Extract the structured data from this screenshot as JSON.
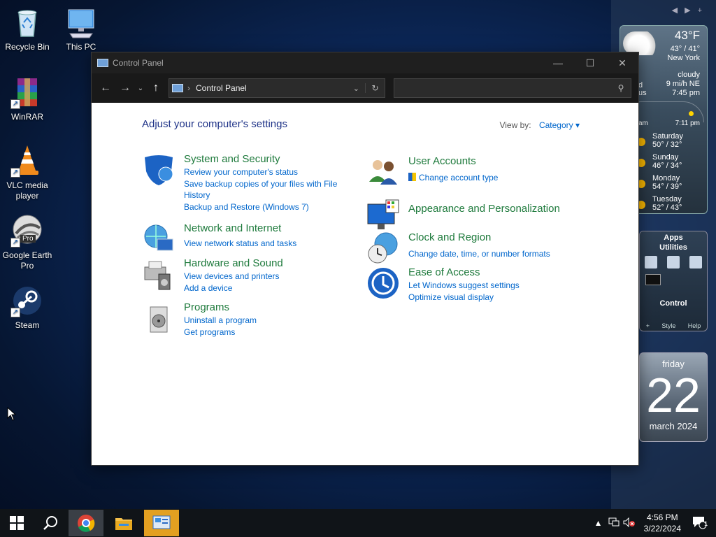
{
  "desktop": {
    "icons": [
      {
        "label": "Recycle Bin"
      },
      {
        "label": "This PC"
      },
      {
        "label": "WinRAR"
      },
      {
        "label": "VLC media player"
      },
      {
        "label": "Google Earth Pro"
      },
      {
        "label": "Steam"
      }
    ],
    "google_earth_badge": "Pro"
  },
  "weather": {
    "temp": "43°F",
    "range": "43° / 41°",
    "city": "New York",
    "condition": "cloudy",
    "wind": "9 mi/h NE",
    "time": "7:45 pm",
    "left_partial_1": "d",
    "left_partial_2": "us",
    "sunrise_partial": "am",
    "sunset": "7:11 pm",
    "forecast": [
      {
        "day": "Saturday",
        "range": "50° / 32°"
      },
      {
        "day": "Sunday",
        "range": "46° / 34°"
      },
      {
        "day": "Monday",
        "range": "54° / 39°"
      },
      {
        "day": "Tuesday",
        "range": "52° / 43°"
      }
    ]
  },
  "apps_gadget": {
    "title": "Apps",
    "subtitle": "Utilities",
    "label": "Control",
    "footer": [
      "+",
      "Style",
      "Help"
    ]
  },
  "calendar": {
    "weekday": "friday",
    "day": "22",
    "month": "march 2024"
  },
  "window": {
    "title": "Control Panel",
    "address": "Control Panel",
    "search_placeholder": "",
    "heading": "Adjust your computer's settings",
    "view_by_label": "View by:",
    "view_by_value": "Category",
    "categories_left": [
      {
        "title": "System and Security",
        "links": [
          "Review your computer's status",
          "Save backup copies of your files with File",
          "History",
          "Backup and Restore (Windows 7)"
        ]
      },
      {
        "title": "Network and Internet",
        "links": [
          "View network status and tasks"
        ]
      },
      {
        "title": "Hardware and Sound",
        "links": [
          "View devices and printers",
          "Add a device"
        ]
      },
      {
        "title": "Programs",
        "links": [
          "Uninstall a program",
          "Get programs"
        ]
      }
    ],
    "categories_right": [
      {
        "title": "User Accounts",
        "links": [
          "Change account type"
        ]
      },
      {
        "title": "Appearance and Personalization",
        "links": []
      },
      {
        "title": "Clock and Region",
        "links": [
          "Change date, time, or number formats"
        ]
      },
      {
        "title": "Ease of Access",
        "links": [
          "Let Windows suggest settings",
          "Optimize visual display"
        ]
      }
    ]
  },
  "taskbar": {
    "time": "4:56 PM",
    "date": "3/22/2024",
    "notification_count": "1"
  },
  "colors": {
    "link": "#0066cc",
    "category_title": "#1e7a3c",
    "heading": "#1e3287",
    "taskbar_active_app": "#e3a021"
  }
}
